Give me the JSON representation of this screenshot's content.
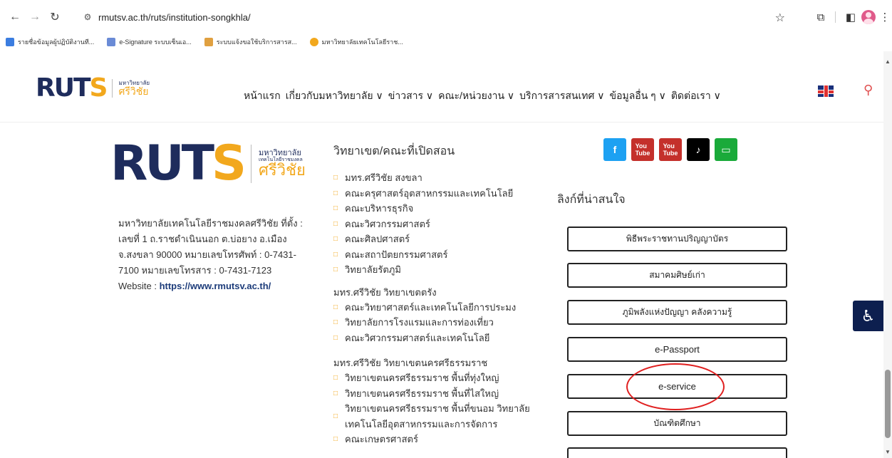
{
  "browser": {
    "url": "rmutsv.ac.th/ruts/institution-songkhla/",
    "bookmarks": [
      {
        "label": "รายชื่อข้อมูลผู้ปฏิบัติงานที...",
        "color": "#3b7de0"
      },
      {
        "label": "e-Signature ระบบเซ็นเอ...",
        "color": "#6a8bd6"
      },
      {
        "label": "ระบบแจ้งขอใช้บริการสารส...",
        "color": "#e0a040"
      },
      {
        "label": "มหาวิทยาลัยเทคโนโลยีราช...",
        "color": "#f2a81d"
      }
    ]
  },
  "header": {
    "logo_text": "RUTS",
    "logo_th_top": "มหาวิทยาลัย",
    "logo_th_bottom": "ศรีวิชัย",
    "menu": [
      "หน้าแรก",
      "เกี่ยวกับมหาวิทยาลัย ∨",
      "ข่าวสาร ∨",
      "คณะ/หน่วยงาน ∨",
      "บริการสารสนเทศ ∨",
      "ข้อมูลอื่น ๆ ∨",
      "ติดต่อเรา ∨"
    ]
  },
  "footer": {
    "big_logo_th_top": "มหาวิทยาลัย",
    "big_logo_th_mid": "เทคโนโลยีราชมงคล",
    "big_logo_th_bottom": "ศรีวิชัย",
    "address_lines": [
      "มหาวิทยาลัยเทคโนโลยีราชมงคลศรีวิชัย ที่ตั้ง :",
      "เลขที่ 1 ถ.ราชดำเนินนอก ต.บ่อยาง อ.เมือง",
      "จ.สงขลา 90000 หมายเลขโทรศัพท์ : 0-7431-",
      "7100 หมายเลขโทรสาร : 0-7431-7123"
    ],
    "website_label": "Website : ",
    "website_url": "https://www.rmutsv.ac.th/",
    "campus_title": "วิทยาเขต/คณะที่เปิดสอน",
    "songkhla_items": [
      "มทร.ศรีวิชัย สงขลา",
      "คณะครุศาสตร์อุตสาหกรรมและเทคโนโลยี",
      "คณะบริหารธุรกิจ",
      "คณะวิศวกรรมศาสตร์",
      "คณะศิลปศาสตร์",
      "คณะสถาปัตยกรรมศาสตร์",
      "วิทยาลัยรัตภูมิ"
    ],
    "trang_title": "มทร.ศรีวิชัย วิทยาเขตตรัง",
    "trang_items": [
      "คณะวิทยาศาสตร์และเทคโนโลยีการประมง",
      "วิทยาลัยการโรงแรมและการท่องเที่ยว",
      "คณะวิศวกรรมศาสตร์และเทคโนโลยี"
    ],
    "nakhon_title": "มทร.ศรีวิชัย วิทยาเขตนครศรีธรรมราช",
    "nakhon_items": [
      "วิทยาเขตนครศรีธรรมราช พื้นที่ทุ่งใหญ่",
      "วิทยาเขตนครศรีธรรมราช พื้นที่ไสใหญ่",
      "วิทยาเขตนครศรีธรรมราช พื้นที่ขนอม วิทยาลัย",
      "คณะเกษตรศาสตร์"
    ],
    "nakhon_item3_line2": "เทคโนโลยีอุตสาหกรรมและการจัดการ",
    "interest_title": "ลิงก์ที่น่าสนใจ",
    "links": [
      "พิธีพระราชทานปริญญาบัตร",
      "สมาคมศิษย์เก่า",
      "ภูมิพลังแห่งปัญญา คลังความรู้",
      "e-Passport",
      "e-service",
      "บัณฑิตศึกษา"
    ],
    "social": [
      {
        "name": "facebook-icon",
        "color": "#1da1f2",
        "glyph": "f"
      },
      {
        "name": "youtube-icon",
        "color": "#c4302b",
        "glyph": "You"
      },
      {
        "name": "youtube-icon-2",
        "color": "#c4302b",
        "glyph": "You"
      },
      {
        "name": "tiktok-icon",
        "color": "#000000",
        "glyph": "♪"
      },
      {
        "name": "line-icon",
        "color": "#1aaa3a",
        "glyph": "▭"
      }
    ]
  }
}
